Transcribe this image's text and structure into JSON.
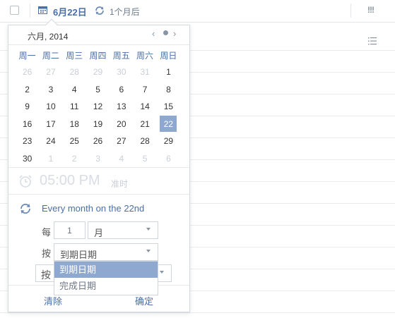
{
  "task_bar": {
    "due_date": "6月22日",
    "repeat_summary": "1个月后",
    "priority": "!!!"
  },
  "calendar": {
    "month_title": "六月, 2014",
    "nav_prev": "‹",
    "nav_next": "›",
    "weekdays": [
      "周一",
      "周二",
      "周三",
      "周四",
      "周五",
      "周六",
      "周日"
    ],
    "days": [
      {
        "d": "26",
        "muted": true
      },
      {
        "d": "27",
        "muted": true
      },
      {
        "d": "28",
        "muted": true
      },
      {
        "d": "29",
        "muted": true
      },
      {
        "d": "30",
        "muted": true
      },
      {
        "d": "31",
        "muted": true
      },
      {
        "d": "1"
      },
      {
        "d": "2"
      },
      {
        "d": "3"
      },
      {
        "d": "4"
      },
      {
        "d": "5"
      },
      {
        "d": "6"
      },
      {
        "d": "7"
      },
      {
        "d": "8"
      },
      {
        "d": "9"
      },
      {
        "d": "10"
      },
      {
        "d": "11"
      },
      {
        "d": "12"
      },
      {
        "d": "13"
      },
      {
        "d": "14"
      },
      {
        "d": "15"
      },
      {
        "d": "16"
      },
      {
        "d": "17"
      },
      {
        "d": "18"
      },
      {
        "d": "19"
      },
      {
        "d": "20"
      },
      {
        "d": "21"
      },
      {
        "d": "22",
        "selected": true
      },
      {
        "d": "23"
      },
      {
        "d": "24"
      },
      {
        "d": "25"
      },
      {
        "d": "26"
      },
      {
        "d": "27"
      },
      {
        "d": "28"
      },
      {
        "d": "29"
      },
      {
        "d": "30"
      },
      {
        "d": "1",
        "muted": true
      },
      {
        "d": "2",
        "muted": true
      },
      {
        "d": "3",
        "muted": true
      },
      {
        "d": "4",
        "muted": true
      },
      {
        "d": "5",
        "muted": true
      },
      {
        "d": "6",
        "muted": true
      }
    ]
  },
  "time": {
    "value": "05:00 PM",
    "ontime_label": "准时"
  },
  "repeat": {
    "description": "Every month on the 22nd",
    "every_label": "每",
    "interval": "1",
    "unit": "月",
    "by_label": "按",
    "basis": "到期日期",
    "behind_field_text": "按",
    "options": [
      {
        "label": "到期日期",
        "active": true
      },
      {
        "label": "完成日期",
        "active": false
      }
    ]
  },
  "footer": {
    "clear": "清除",
    "ok": "确定"
  },
  "colors": {
    "accent": "#4a6fa5",
    "selected_bg": "#8fa8cf"
  }
}
